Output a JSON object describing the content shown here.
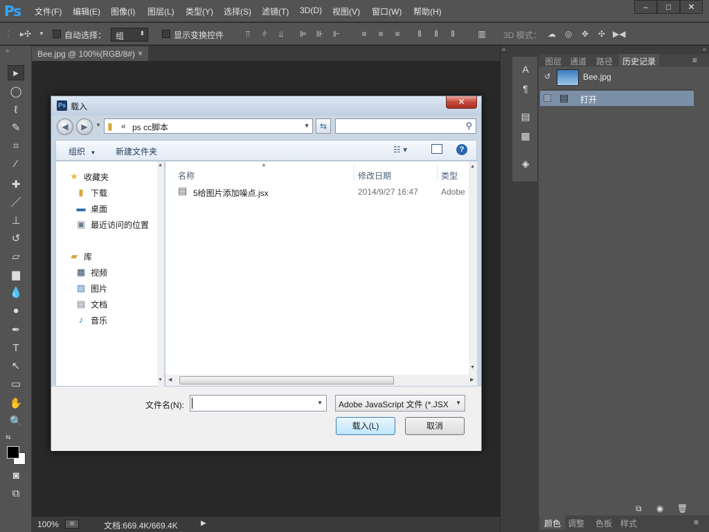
{
  "app": {
    "logo": "Ps",
    "menu": [
      "文件(F)",
      "编辑(E)",
      "图像(I)",
      "图层(L)",
      "类型(Y)",
      "选择(S)",
      "滤镜(T)",
      "3D(D)",
      "视图(V)",
      "窗口(W)",
      "帮助(H)"
    ],
    "window_controls": {
      "minimize": "–",
      "maximize": "□",
      "close": "✕"
    }
  },
  "options_bar": {
    "auto_select_label": "自动选择：",
    "auto_select_value": "组",
    "show_transform_label": "显示变换控件",
    "mode_3d_label": "3D 模式："
  },
  "document": {
    "tab_title": "Bee.jpg @ 100%(RGB/8#)",
    "tab_close": "×",
    "zoom": "100%",
    "doc_info": "文档:669.4K/669.4K"
  },
  "panels": {
    "tabs": [
      "图层",
      "通道",
      "路径",
      "历史记录"
    ],
    "active_tab": "历史记录",
    "history_snapshot": "Bee.jpg",
    "history_items": [
      "打开"
    ],
    "bottom_tabs": [
      "颜色",
      "调整",
      "色板",
      "样式"
    ]
  },
  "dialog": {
    "title": "载入",
    "close_label": "✕",
    "address_prefix": "«",
    "address_path": "ps cc脚本",
    "search_placeholder": "",
    "organize_label": "组织",
    "new_folder_label": "新建文件夹",
    "nav": {
      "favorites_header": "收藏夹",
      "favorites": [
        "下载",
        "桌面",
        "最近访问的位置"
      ],
      "libraries_header": "库",
      "libraries": [
        "视频",
        "图片",
        "文档",
        "音乐"
      ]
    },
    "columns": {
      "name": "名称",
      "modified": "修改日期",
      "type": "类型"
    },
    "files": [
      {
        "name": "5给图片添加噪点.jsx",
        "modified": "2014/9/27 16:47",
        "type": "Adobe"
      }
    ],
    "filename_label": "文件名(N):",
    "filename_value": "",
    "filter_value": "Adobe JavaScript 文件 (*.JSX",
    "load_button": "载入(L)",
    "cancel_button": "取消"
  },
  "colors": {
    "ps_blue": "#31a8ff",
    "history_selection": "#7b8fa8",
    "dialog_frame": "#cbd6e3"
  }
}
